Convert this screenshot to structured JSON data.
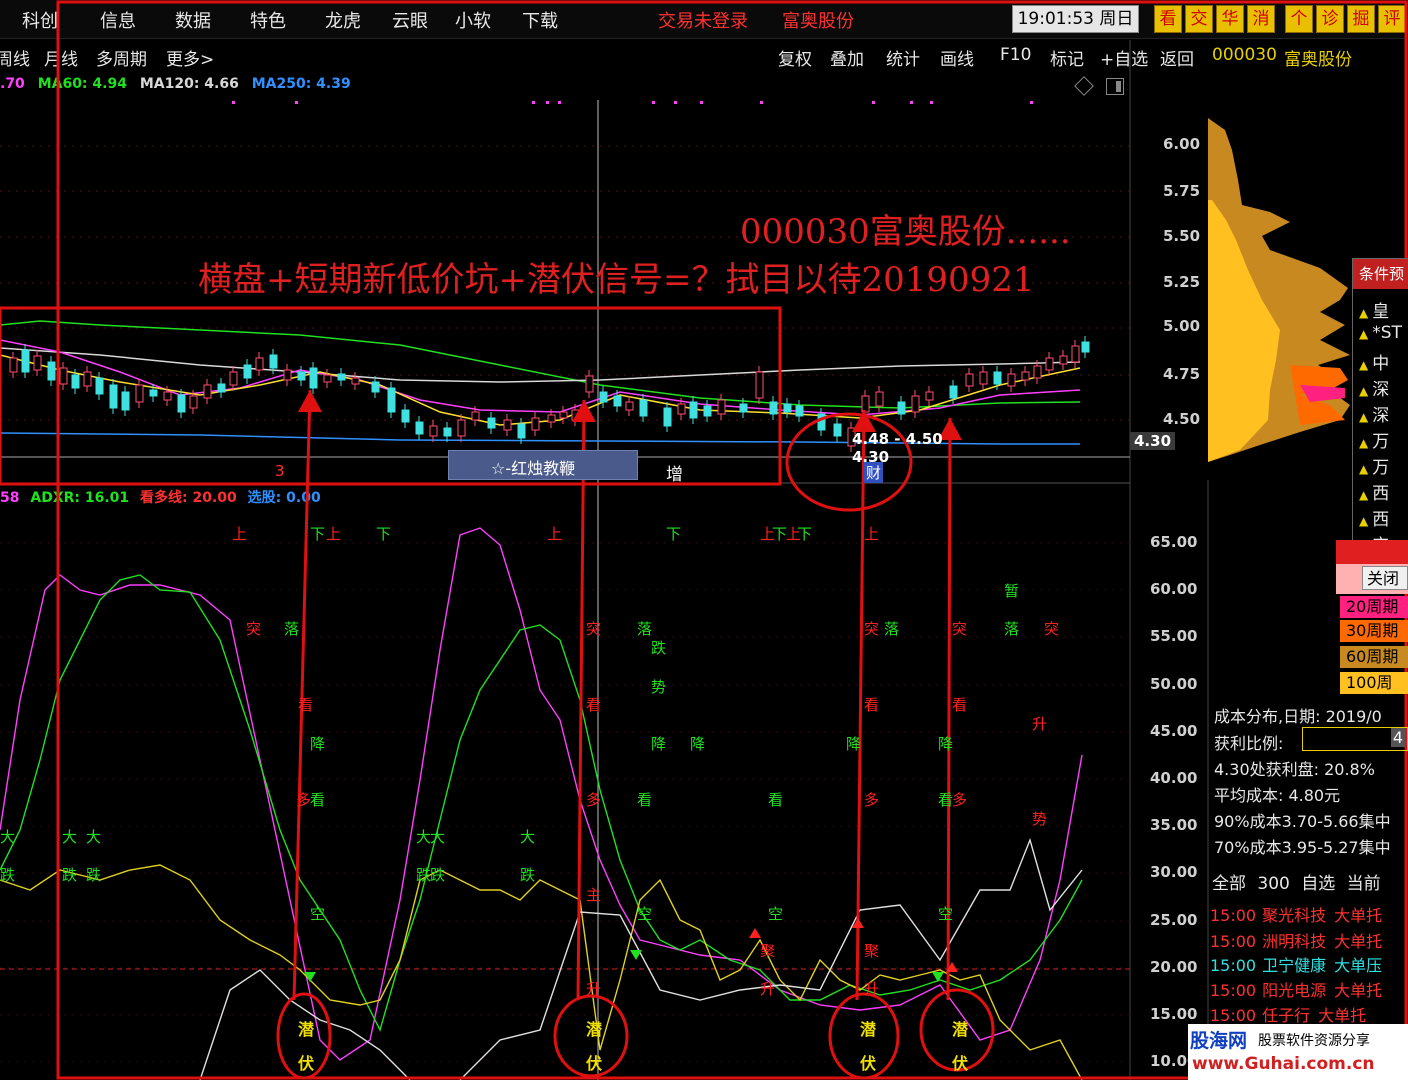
{
  "menu": {
    "items": [
      "科创",
      "信息",
      "数据",
      "特色",
      "龙虎",
      "云眼",
      "小软",
      "下载"
    ],
    "login_status": "交易未登录",
    "stock_name": "富奥股份",
    "time": "19:01:53",
    "weekday": "周日",
    "tools": [
      "看",
      "交",
      "华",
      "消",
      "个",
      "诊",
      "掘",
      "评"
    ]
  },
  "periods": {
    "items": [
      "周线",
      "月线",
      "多周期",
      "更多"
    ],
    "more_arrow": ">"
  },
  "toolbar": {
    "items": [
      "复权",
      "叠加",
      "统计",
      "画线",
      "F10",
      "标记",
      "+自选",
      "返回"
    ],
    "code": "000030",
    "name": "富奥股份"
  },
  "ma_row": {
    "ma_partial": ".70",
    "ma60": "MA60: 4.94",
    "ma120": "MA120: 4.66",
    "ma250": "MA250: 4.39"
  },
  "indicator_row": {
    "partial": "58",
    "adxr": "ADXR: 16.01",
    "kanduo": "看多线: 20.00",
    "xuangu": "选股: 0.00"
  },
  "price_axis": [
    "6.00",
    "5.75",
    "5.50",
    "5.25",
    "5.00",
    "4.75",
    "4.50"
  ],
  "current_price": "4.30",
  "osc_axis": [
    "65.00",
    "60.00",
    "55.00",
    "50.00",
    "45.00",
    "40.00",
    "35.00",
    "30.00",
    "25.00",
    "20.00",
    "15.00",
    "10.00"
  ],
  "annotations": {
    "title": "000030富奥股份......",
    "subtitle": "横盘+短期新低价坑+潜伏信号=？拭目以待20190921",
    "low_range": "4.48 - 4.50",
    "low_price": "4.30",
    "cai": "财",
    "zeng": "增",
    "hongzhu": "☆-红烛教鞭",
    "mark_3": "3"
  },
  "signals": {
    "qian": "潜",
    "fu": "伏",
    "shang": "上",
    "xia": "下",
    "tu": "突",
    "luo": "落",
    "die": "跌",
    "shi": "势",
    "kan": "看",
    "jiang": "降",
    "duo": "多",
    "da": "大",
    "kong": "空",
    "zhu": "主",
    "sheng": "升",
    "zan": "暂",
    "ju": "聚"
  },
  "watch_panel": {
    "title": "条件预",
    "items": [
      "皇",
      "*ST",
      "中",
      "深",
      "深",
      "万",
      "万",
      "西",
      "西",
      "宝"
    ]
  },
  "close_label": "关闭",
  "chip_legend": [
    {
      "label": "20周期",
      "color": "#ff2080"
    },
    {
      "label": "30周期",
      "color": "#ff6a00"
    },
    {
      "label": "60周期",
      "color": "#c88a20"
    },
    {
      "label": "100周期",
      "color": "#ffc020"
    }
  ],
  "cost_info": {
    "date": "成本分布,日期: 2019/0",
    "profit_ratio_label": "获利比例:",
    "profit_ratio_value": "4",
    "profit_at": "4.30处获利盘: 20.8%",
    "avg_cost": "平均成本: 4.80元",
    "c90": "90%成本3.70-5.66集中",
    "c70": "70%成本3.95-5.27集中"
  },
  "stock_list_header": [
    "全部",
    "300",
    "自选",
    "当前"
  ],
  "stock_list": [
    {
      "time": "15:00",
      "name": "聚光科技",
      "signal": "大单托"
    },
    {
      "time": "15:00",
      "name": "洲明科技",
      "signal": "大单托"
    },
    {
      "time": "15:00",
      "name": "卫宁健康",
      "signal": "大单压"
    },
    {
      "time": "15:00",
      "name": "阳光电源",
      "signal": "大单托"
    },
    {
      "time": "15:00",
      "name": "任子行",
      "signal": "大单托"
    }
  ],
  "footer": {
    "logo": "股海网",
    "tagline": "股票软件资源分享",
    "url": "www.Guhai.com.cn"
  },
  "colors": {
    "annotation_red": "#e02020",
    "ma_magenta": "#ff40ff",
    "ma_green": "#20e020",
    "ma_blue": "#3090ff",
    "candle_up": "#ff4060",
    "candle_down": "#40e0e0"
  }
}
